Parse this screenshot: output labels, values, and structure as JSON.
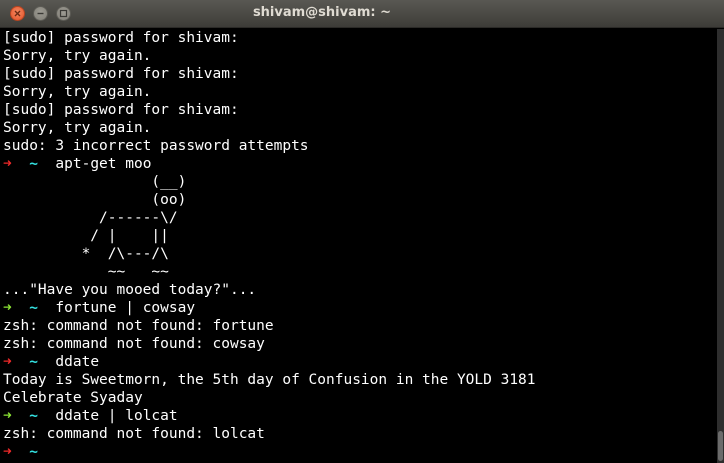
{
  "window": {
    "title": "shivam@shivam: ~",
    "close_icon": "close-icon",
    "minimize_icon": "minimize-icon",
    "maximize_icon": "maximize-icon"
  },
  "colors": {
    "prompt_arrow_error": "#ef2929",
    "prompt_arrow_ok": "#8ae234",
    "prompt_dir": "#34e2e2",
    "text": "#ffffff",
    "background": "#000000"
  },
  "terminal": {
    "lines": [
      {
        "type": "output",
        "text": "[sudo] password for shivam:"
      },
      {
        "type": "output",
        "text": "Sorry, try again."
      },
      {
        "type": "output",
        "text": "[sudo] password for shivam:"
      },
      {
        "type": "output",
        "text": "Sorry, try again."
      },
      {
        "type": "output",
        "text": "[sudo] password for shivam:"
      },
      {
        "type": "output",
        "text": "Sorry, try again."
      },
      {
        "type": "output",
        "text": "sudo: 3 incorrect password attempts"
      },
      {
        "type": "prompt",
        "status": "error",
        "arrow": "➜",
        "dir": "~",
        "command": "apt-get moo"
      },
      {
        "type": "output",
        "text": "                 (__)"
      },
      {
        "type": "output",
        "text": "                 (oo)"
      },
      {
        "type": "output",
        "text": "           /------\\/"
      },
      {
        "type": "output",
        "text": "          / |    ||"
      },
      {
        "type": "output",
        "text": "         *  /\\---/\\"
      },
      {
        "type": "output",
        "text": "            ~~   ~~"
      },
      {
        "type": "output",
        "text": "...\"Have you mooed today?\"..."
      },
      {
        "type": "prompt",
        "status": "ok",
        "arrow": "➜",
        "dir": "~",
        "command": "fortune | cowsay"
      },
      {
        "type": "output",
        "text": "zsh: command not found: fortune"
      },
      {
        "type": "output",
        "text": "zsh: command not found: cowsay"
      },
      {
        "type": "prompt",
        "status": "error",
        "arrow": "➜",
        "dir": "~",
        "command": "ddate"
      },
      {
        "type": "output",
        "text": "Today is Sweetmorn, the 5th day of Confusion in the YOLD 3181"
      },
      {
        "type": "output",
        "text": "Celebrate Syaday"
      },
      {
        "type": "prompt",
        "status": "ok",
        "arrow": "➜",
        "dir": "~",
        "command": "ddate | lolcat"
      },
      {
        "type": "output",
        "text": "zsh: command not found: lolcat"
      },
      {
        "type": "prompt",
        "status": "error",
        "arrow": "➜",
        "dir": "~",
        "command": ""
      }
    ]
  }
}
